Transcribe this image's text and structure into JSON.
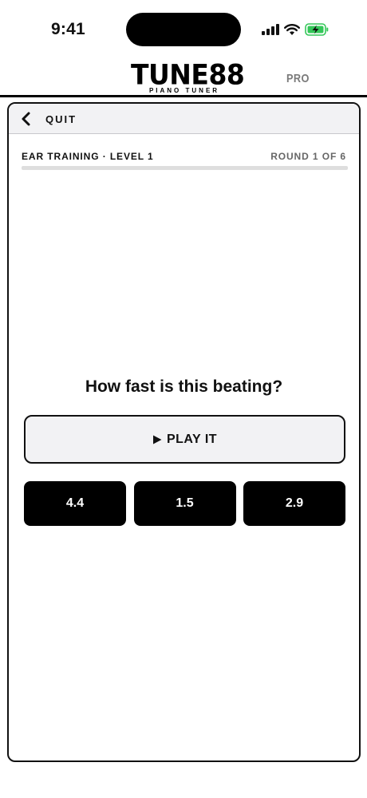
{
  "status_bar": {
    "time": "9:41",
    "icons": [
      "cellular-signal-icon",
      "wifi-icon",
      "battery-charging-icon"
    ],
    "battery_color": "#34c759"
  },
  "header": {
    "logo_title": "TUNE88",
    "logo_subtitle": "PIANO TUNER",
    "pro_badge": "PRO"
  },
  "topbar": {
    "back_icon": "chevron-left-icon",
    "quit_label": "QUIT"
  },
  "exercise": {
    "level_label": "EAR TRAINING · LEVEL 1",
    "round_label": "ROUND 1 OF 6",
    "progress": 0,
    "question": "How fast is this beating?",
    "play_label": "PLAY IT",
    "play_icon": "play-icon",
    "answers": [
      "4.4",
      "1.5",
      "2.9"
    ]
  },
  "colors": {
    "accent": "#000000",
    "surface": "#f2f2f4",
    "muted_text": "#666666",
    "pro_text": "#7a7a7a"
  }
}
